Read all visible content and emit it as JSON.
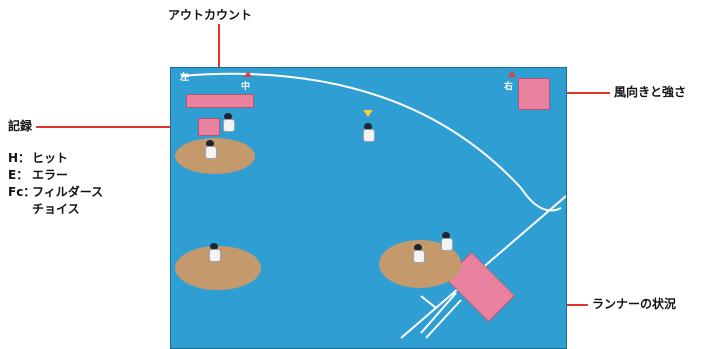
{
  "annotations": {
    "out_count": "アウトカウント",
    "wind": "風向きと強さ",
    "record": "記録",
    "runners": "ランナーの状況"
  },
  "record_codes": [
    {
      "key": "H：",
      "label": "ヒット"
    },
    {
      "key": "E：",
      "label": "エラー"
    },
    {
      "key": "Fc：",
      "label": "フィルダース"
    },
    {
      "key": "",
      "label": "チョイス"
    }
  ],
  "field_labels": {
    "left": "左",
    "center": "中",
    "right": "右"
  },
  "colors": {
    "field": "#2e9ed3",
    "infield_dirt": "#c49a6c",
    "indicator_box": "#e8829f",
    "callout_line": "#e0352b",
    "foul_line": "#ffffff"
  }
}
